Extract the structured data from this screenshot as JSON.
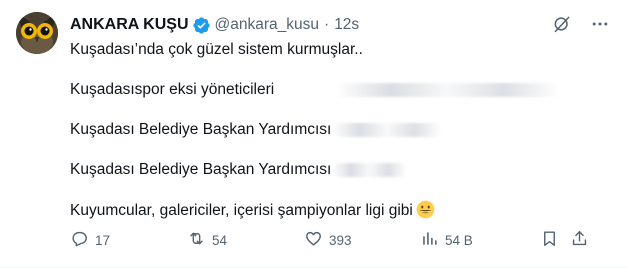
{
  "author": {
    "display_name": "ANKARA KUŞU",
    "handle": "@ankara_kusu",
    "separator": "·",
    "time": "12s",
    "avatar_icon": "owl-avatar-icon",
    "verified_icon": "verified-badge-icon"
  },
  "top_actions": {
    "grok_icon": "grok-icon",
    "more_icon": "more-icon"
  },
  "tweet": {
    "lines": [
      "Kuşadası’nda çok güzel sistem kurmuşlar..",
      "Kuşadasıspor eksi yöneticileri",
      "Kuşadası Belediye Başkan Yardımcısı",
      "Kuşadası Belediye Başkan Yardımcısı",
      "Kuyumcular, galericiler, içerisi şampiyonlar ligi gibi"
    ],
    "emoji": "grinning-face-emoji"
  },
  "actions": {
    "reply_count": "17",
    "retweet_count": "54",
    "like_count": "393",
    "view_count": "54 B",
    "reply_icon": "reply-icon",
    "retweet_icon": "retweet-icon",
    "like_icon": "heart-icon",
    "views_icon": "views-icon",
    "bookmark_icon": "bookmark-icon",
    "share_icon": "share-icon"
  },
  "colors": {
    "text": "#0f1419",
    "secondary": "#536471",
    "verified": "#1d9bf0",
    "background": "#ffffff"
  }
}
